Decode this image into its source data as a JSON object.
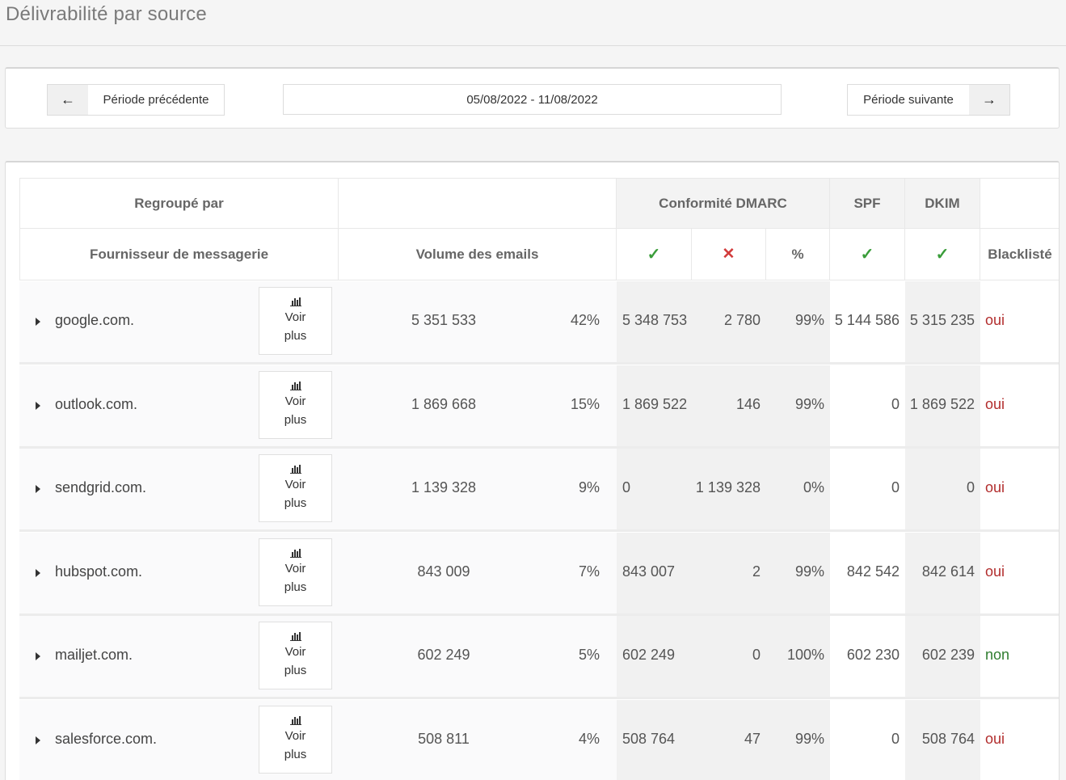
{
  "page": {
    "title": "Délivrabilité par source"
  },
  "period": {
    "prev_label": "Période précédente",
    "next_label": "Période suivante",
    "date_range": "05/08/2022 - 11/08/2022",
    "prev_icon": "arrow-left-icon",
    "next_icon": "arrow-right-icon"
  },
  "table": {
    "group_header": "Regroupé par",
    "provider_header": "Fournisseur de messagerie",
    "volume_header": "Volume des emails",
    "dmarc_header": "Conformité DMARC",
    "spf_header": "SPF",
    "dkim_header": "DKIM",
    "blacklist_header": "Blacklisté",
    "check": "✓",
    "cross": "✕",
    "percent": "%",
    "voir_line1": "Voir",
    "voir_line2": "plus",
    "rows": [
      {
        "domain": "google.com.",
        "volume": "5 351 533",
        "volume_pct": "42%",
        "dmarc_ok": "5 348 753",
        "dmarc_ko": "2 780",
        "dmarc_pct": "99%",
        "spf": "5 144 586",
        "dkim": "5 315 235",
        "blacklist": "oui"
      },
      {
        "domain": "outlook.com.",
        "volume": "1 869 668",
        "volume_pct": "15%",
        "dmarc_ok": "1 869 522",
        "dmarc_ko": "146",
        "dmarc_pct": "99%",
        "spf": "0",
        "dkim": "1 869 522",
        "blacklist": "oui"
      },
      {
        "domain": "sendgrid.com.",
        "volume": "1 139 328",
        "volume_pct": "9%",
        "dmarc_ok": "0",
        "dmarc_ko": "1 139 328",
        "dmarc_pct": "0%",
        "spf": "0",
        "dkim": "0",
        "blacklist": "oui"
      },
      {
        "domain": "hubspot.com.",
        "volume": "843 009",
        "volume_pct": "7%",
        "dmarc_ok": "843 007",
        "dmarc_ko": "2",
        "dmarc_pct": "99%",
        "spf": "842 542",
        "dkim": "842 614",
        "blacklist": "oui"
      },
      {
        "domain": "mailjet.com.",
        "volume": "602 249",
        "volume_pct": "5%",
        "dmarc_ok": "602 249",
        "dmarc_ko": "0",
        "dmarc_pct": "100%",
        "spf": "602 230",
        "dkim": "602 239",
        "blacklist": "non"
      },
      {
        "domain": "salesforce.com.",
        "volume": "508 811",
        "volume_pct": "4%",
        "dmarc_ok": "508 764",
        "dmarc_ko": "47",
        "dmarc_pct": "99%",
        "spf": "0",
        "dkim": "508 764",
        "blacklist": "oui"
      }
    ]
  }
}
